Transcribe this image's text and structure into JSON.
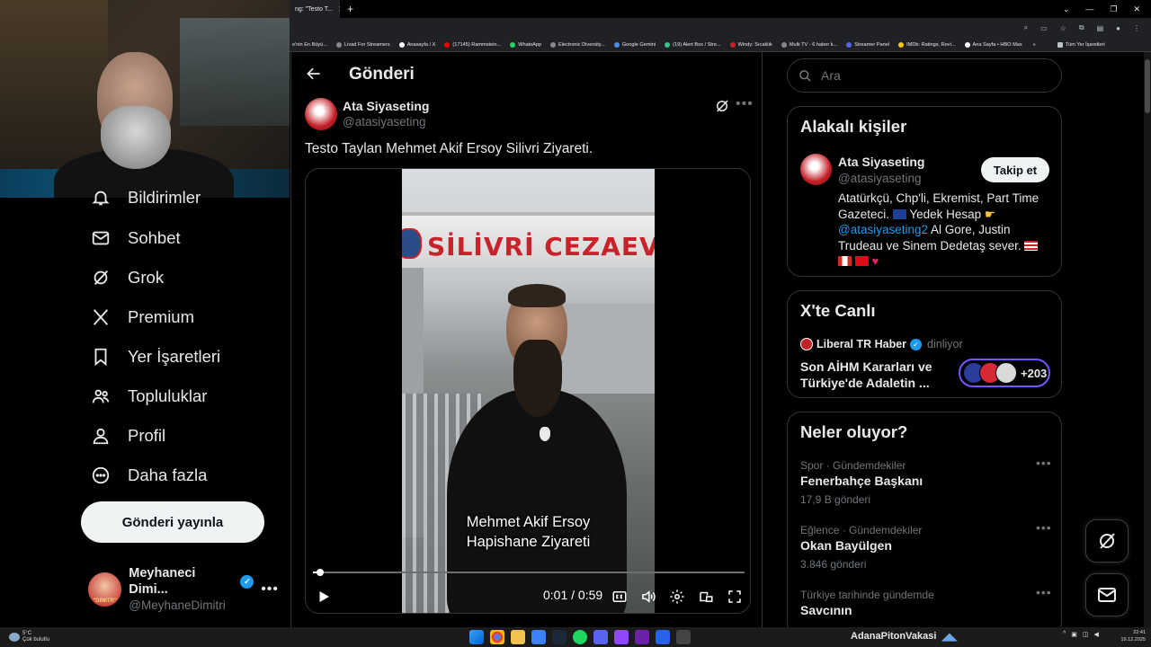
{
  "browser": {
    "tab_title": "ng: \"Testo T...",
    "bookmarks": [
      "e'nin En Büyü...",
      "Livad For Streamers",
      "Anasayfa / X",
      "(17145) Rammstein...",
      "WhatsApp",
      "Electronic Diversity...",
      "Google Gemini",
      "(19) Alert Box / Stre...",
      "Windy: Sıcaklık",
      "Multi TV - 6 haber k...",
      "Streamer Panel",
      "IMDb: Ratings, Revi...",
      "Ana Sayfa • HBO Max"
    ],
    "bookmarks_more": "»",
    "bookmarks_all": "Tüm Yer İşaretleri"
  },
  "sidebar": {
    "items": [
      {
        "label": "Bildirimler",
        "icon": "bell-icon"
      },
      {
        "label": "Sohbet",
        "icon": "mail-icon"
      },
      {
        "label": "Grok",
        "icon": "grok-icon"
      },
      {
        "label": "Premium",
        "icon": "x-logo-icon"
      },
      {
        "label": "Yer İşaretleri",
        "icon": "bookmark-icon"
      },
      {
        "label": "Topluluklar",
        "icon": "communities-icon"
      },
      {
        "label": "Profil",
        "icon": "profile-icon"
      },
      {
        "label": "Daha fazla",
        "icon": "more-circle-icon"
      }
    ],
    "post_button": "Gönderi yayınla",
    "account": {
      "name": "Meyhaneci Dimi...",
      "handle": "@MeyhaneDimitri",
      "avatar_text": "DIMITRI",
      "more": "•••"
    }
  },
  "main": {
    "title": "Gönderi",
    "author": {
      "name": "Ata Siyaseting",
      "handle": "@atasiyaseting"
    },
    "more": "•••",
    "text": "Testo Taylan Mehmet Akif Ersoy Silivri Ziyareti.",
    "video": {
      "sign_text": "SİLİVRİ CEZAEV",
      "caption_line1": "Mehmet Akif Ersoy",
      "caption_line2": "Hapishane Ziyareti",
      "time": "0:01 / 0:59",
      "progress": 0.017
    }
  },
  "right": {
    "search_placeholder": "Ara",
    "related": {
      "title": "Alakalı kişiler",
      "name": "Ata Siyaseting",
      "handle": "@atasiyaseting",
      "follow": "Takip et",
      "bio_part1": "Atatürkçü, Chp'li, Ekremist, Part Time Gazeteci.",
      "bio_part2": "Yedek Hesap",
      "bio_link": "@atasiyaseting2",
      "bio_part3": "Al Gore, Justin Trudeau ve Sinem Dedetaş sever."
    },
    "live": {
      "title": "X'te Canlı",
      "host": "Liberal TR Haber",
      "status": "dinliyor",
      "space_title": "Son AİHM Kararları ve Türkiye'de Adaletin ...",
      "listeners": "+203"
    },
    "trends": {
      "title": "Neler oluyor?",
      "items": [
        {
          "meta": "Spor · Gündemdekiler",
          "name": "Fenerbahçe Başkanı",
          "count": "17,9 B gönderi"
        },
        {
          "meta": "Eğlence · Gündemdekiler",
          "name": "Okan Bayülgen",
          "count": "3.846 gönderi"
        },
        {
          "meta": "Türkiye tarihinde gündemde",
          "name": "Savcının",
          "count": ""
        }
      ],
      "more": "•••"
    }
  },
  "taskbar": {
    "weather_temp": "5°C",
    "weather_desc": "Çok bulutlu",
    "ticker": "AdanaPitonVakasi",
    "clock_time": "22:41",
    "clock_date": "19.12.2025"
  },
  "colors": {
    "accent": "#1d9bf0",
    "background": "#000000",
    "border": "#2f3336",
    "muted": "#71767b",
    "live_ring": "#7856ff"
  }
}
